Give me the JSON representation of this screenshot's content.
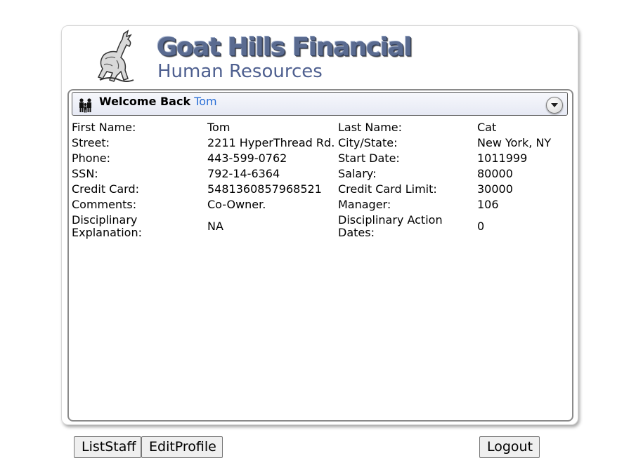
{
  "header": {
    "title": "Goat Hills Financial",
    "subtitle": "Human Resources"
  },
  "panel": {
    "welcome_label": "Welcome Back",
    "user_name": "Tom"
  },
  "profile": {
    "first_name_label": "First Name:",
    "first_name": "Tom",
    "last_name_label": "Last Name:",
    "last_name": "Cat",
    "street_label": "Street:",
    "street": "2211 HyperThread Rd.",
    "city_state_label": "City/State:",
    "city_state": "New York, NY",
    "phone_label": "Phone:",
    "phone": "443-599-0762",
    "start_date_label": "Start Date:",
    "start_date": "1011999",
    "ssn_label": "SSN:",
    "ssn": "792-14-6364",
    "salary_label": "Salary:",
    "salary": "80000",
    "credit_card_label": "Credit Card:",
    "credit_card": "5481360857968521",
    "credit_limit_label": "Credit Card Limit:",
    "credit_limit": "30000",
    "comments_label": "Comments:",
    "comments": "Co-Owner.",
    "manager_label": "Manager:",
    "manager": "106",
    "disc_explanation_label": "Disciplinary Explanation:",
    "disc_explanation": "NA",
    "disc_dates_label": "Disciplinary Action Dates:",
    "disc_dates": "0"
  },
  "buttons": {
    "list_staff": "ListStaff",
    "edit_profile": "EditProfile",
    "logout": "Logout"
  },
  "colors": {
    "logo": "#5a6b90",
    "username_link": "#2a6fd6"
  }
}
